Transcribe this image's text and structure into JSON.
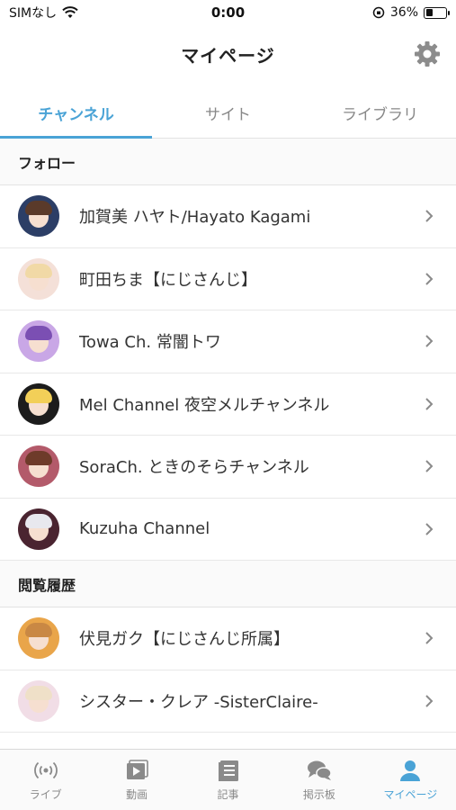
{
  "status_bar": {
    "carrier": "SIMなし",
    "time": "0:00",
    "battery": "36%",
    "battery_level": 0.36
  },
  "header": {
    "title": "マイページ"
  },
  "tabs": [
    {
      "label": "チャンネル",
      "active": true
    },
    {
      "label": "サイト",
      "active": false
    },
    {
      "label": "ライブラリ",
      "active": false
    }
  ],
  "follow_section": {
    "title": "フォロー",
    "items": [
      {
        "label": "加賀美 ハヤト/Hayato Kagami",
        "bg": "#2c3e66",
        "hair": "#5a3a2a"
      },
      {
        "label": "町田ちま【にじさんじ】",
        "bg": "#f4e0d8",
        "hair": "#f1d9a6"
      },
      {
        "label": "Towa Ch. 常闇トワ",
        "bg": "#c9a7e6",
        "hair": "#7b4fb3"
      },
      {
        "label": "Mel Channel 夜空メルチャンネル",
        "bg": "#1c1c1c",
        "hair": "#f2cf58"
      },
      {
        "label": "SoraCh. ときのそらチャンネル",
        "bg": "#b35a6a",
        "hair": "#6e3b2a"
      },
      {
        "label": "Kuzuha Channel",
        "bg": "#4a2430",
        "hair": "#e8e8ee"
      }
    ]
  },
  "history_section": {
    "title": "閲覧履歴",
    "items": [
      {
        "label": "伏見ガク【にじさんじ所属】",
        "bg": "#e9a54a",
        "hair": "#c98844"
      },
      {
        "label": "シスター・クレア -SisterClaire-",
        "bg": "#f1dde6",
        "hair": "#efe0c8"
      }
    ]
  },
  "bottom_nav": [
    {
      "label": "ライブ",
      "icon": "broadcast-icon",
      "active": false
    },
    {
      "label": "動画",
      "icon": "video-icon",
      "active": false
    },
    {
      "label": "記事",
      "icon": "article-icon",
      "active": false
    },
    {
      "label": "掲示板",
      "icon": "chat-bubbles-icon",
      "active": false
    },
    {
      "label": "マイページ",
      "icon": "person-icon",
      "active": true
    }
  ],
  "colors": {
    "accent": "#4aa3d6",
    "inactive": "#8a8a8a"
  }
}
